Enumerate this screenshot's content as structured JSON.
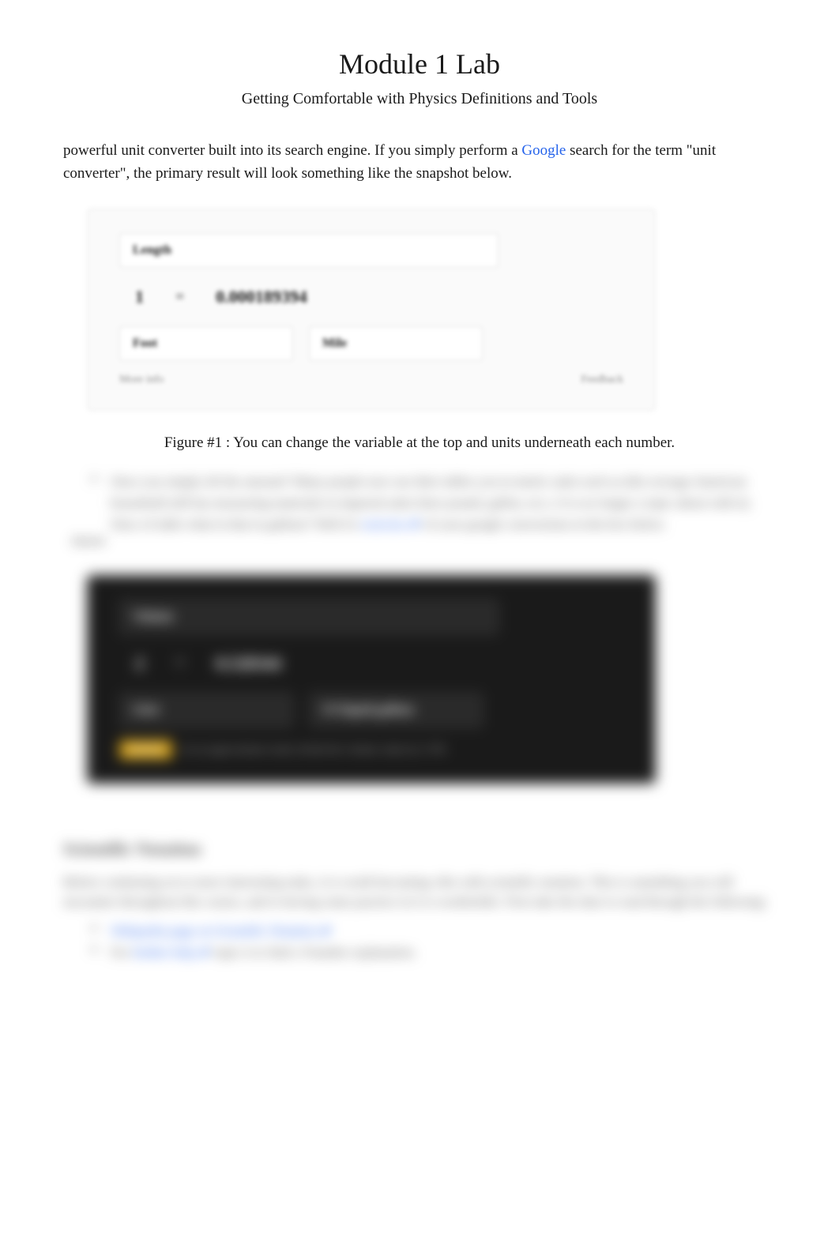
{
  "page": {
    "title": "Module 1 Lab",
    "subtitle": "Getting Comfortable with Physics Definitions and Tools"
  },
  "intro": {
    "text_before_link": "powerful unit converter built into its search engine. If you simply perform a ",
    "link_text": "Google",
    "text_after_link": " search for the term \"unit converter\", the primary result will look something like the snapshot below."
  },
  "figure1": {
    "converter": {
      "category": "Length",
      "left_value": "1",
      "equals": "=",
      "right_value": "0.000189394",
      "left_unit": "Foot",
      "right_unit": "Mile",
      "more_info": "More info",
      "feedback": "Feedback"
    },
    "caption_label": "Figure #1",
    "caption_text": ": You can change the variable at the top and units underneath each number."
  },
  "blurred": {
    "bullet_text": "Once you simply tilt the amount? Many people now use their tables you in metric units such as (the average American household still has measuring materials in imperial units liters pound, gallon, etc.). It is no longer a topic about with it). Once of table what in that in gallons? Well it's",
    "bullet_link": "exercise ⬈",
    "bullet_after": "of your google conversions in the box below.",
    "answer_label": "Answer"
  },
  "figure2": {
    "converter": {
      "category": "Volume",
      "left_value": "2",
      "equals": "=",
      "right_value": "0.528344",
      "left_unit": "Liter",
      "right_unit": "US liquid gallons",
      "badge": "★★★★",
      "approval_text": "As an approximate result, divide the volume value by 3.785"
    }
  },
  "scientific": {
    "header": "Scientific Notation",
    "body": "Before continuing on to more interesting tasks, it is worth becoming vibe with scientific notation. This is something you will encounter throughout this course, and to having some practice in it is worthwhile. First take the time to read through the following:",
    "links": {
      "item1": "Wikipedia page on Scientific Notation ⬈",
      "item2_pre": "For ",
      "item2_link": "further help ⬈",
      "item2_post": " topic it to find a Youtube explanation."
    }
  }
}
